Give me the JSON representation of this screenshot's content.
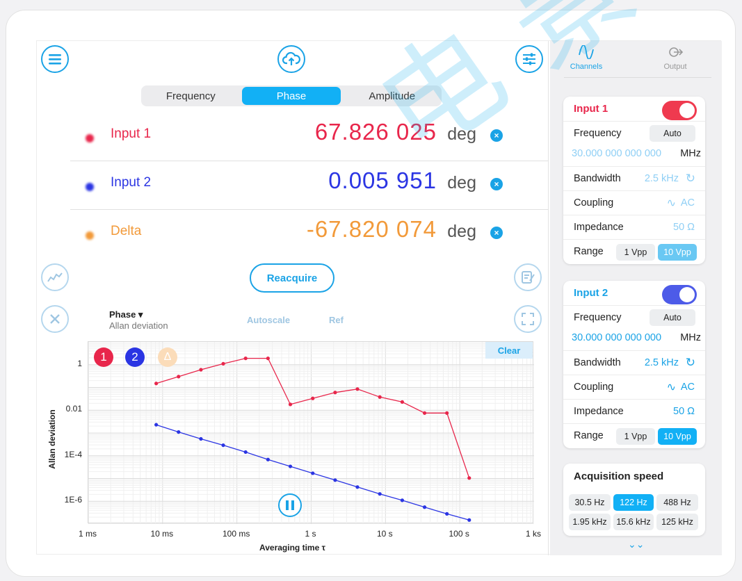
{
  "top_segment": {
    "items": [
      "Frequency",
      "Phase",
      "Amplitude"
    ],
    "active": "Phase"
  },
  "readings": [
    {
      "name": "Input 1",
      "value": "67.826 025",
      "unit": "deg",
      "color": "#e8264b"
    },
    {
      "name": "Input 2",
      "value": "0.005 951",
      "unit": "deg",
      "color": "#2b35e3"
    },
    {
      "name": "Delta",
      "value": "-67.820 074",
      "unit": "deg",
      "color": "#f29a3a"
    }
  ],
  "reacquire_label": "Reacquire",
  "plot_controls": {
    "mode": "Phase",
    "mode_sub": "Allan deviation",
    "autoscale": "Autoscale",
    "ref": "Ref",
    "clear": "Clear"
  },
  "channel_badges": [
    "1",
    "2",
    "Δ"
  ],
  "right_tabs": [
    {
      "label": "Channels",
      "active": true
    },
    {
      "label": "Output",
      "active": false
    }
  ],
  "input1": {
    "title": "Input 1",
    "enabled": true,
    "frequency_label": "Frequency",
    "frequency_mode": "Auto",
    "frequency_value": "30.000 000 000 000",
    "frequency_unit": "MHz",
    "bandwidth_label": "Bandwidth",
    "bandwidth_value": "2.5 kHz",
    "coupling_label": "Coupling",
    "coupling_value": "AC",
    "impedance_label": "Impedance",
    "impedance_value": "50 Ω",
    "range_label": "Range",
    "range_options": [
      "1 Vpp",
      "10 Vpp"
    ],
    "range_selected": "10 Vpp"
  },
  "input2": {
    "title": "Input 2",
    "enabled": true,
    "frequency_label": "Frequency",
    "frequency_mode": "Auto",
    "frequency_value": "30.000 000 000 000",
    "frequency_unit": "MHz",
    "bandwidth_label": "Bandwidth",
    "bandwidth_value": "2.5 kHz",
    "coupling_label": "Coupling",
    "coupling_value": "AC",
    "impedance_label": "Impedance",
    "impedance_value": "50 Ω",
    "range_label": "Range",
    "range_options": [
      "1 Vpp",
      "10 Vpp"
    ],
    "range_selected": "10 Vpp"
  },
  "acq": {
    "title": "Acquisition speed",
    "options": [
      "30.5 Hz",
      "122 Hz",
      "488 Hz",
      "1.95 kHz",
      "15.6 kHz",
      "125 kHz"
    ],
    "selected": "122 Hz"
  },
  "colors": {
    "accent": "#1aa3e6",
    "input1": "#e8264b",
    "input2": "#2b35e3",
    "delta": "#f29a3a",
    "toggle1": "#ef3a4f",
    "toggle2": "#4d5be8"
  },
  "watermark": "电 景 翼 光 电",
  "chart_data": {
    "type": "scatter",
    "xscale": "log",
    "yscale": "log",
    "xlabel": "Averaging time τ",
    "ylabel": "Allan deviation",
    "xlim": [
      0.001,
      1000
    ],
    "ylim": [
      1e-07,
      10
    ],
    "xticks": [
      {
        "v": 0.001,
        "label": "1 ms"
      },
      {
        "v": 0.01,
        "label": "10 ms"
      },
      {
        "v": 0.1,
        "label": "100 ms"
      },
      {
        "v": 1,
        "label": "1 s"
      },
      {
        "v": 10,
        "label": "10 s"
      },
      {
        "v": 100,
        "label": "100 s"
      },
      {
        "v": 1000,
        "label": "1 ks"
      }
    ],
    "yticks": [
      {
        "v": 1,
        "label": "1"
      },
      {
        "v": 0.01,
        "label": "0.01"
      },
      {
        "v": 0.0001,
        "label": "1E-4"
      },
      {
        "v": 1e-06,
        "label": "1E-6"
      }
    ],
    "grid": true,
    "series": [
      {
        "name": "1",
        "color": "#e8264b",
        "x": [
          0.0082,
          0.0164,
          0.0328,
          0.0655,
          0.131,
          0.262,
          0.524,
          1.05,
          2.1,
          4.19,
          8.39,
          16.8,
          33.6,
          67.1,
          134
        ],
        "y": [
          0.15,
          0.3,
          0.6,
          1.1,
          1.9,
          1.9,
          0.018,
          0.033,
          0.06,
          0.085,
          0.038,
          0.023,
          0.0075,
          0.0075,
          1.05e-05
        ]
      },
      {
        "name": "2",
        "color": "#2b35e3",
        "x": [
          0.0082,
          0.0164,
          0.0328,
          0.0655,
          0.131,
          0.262,
          0.524,
          1.05,
          2.1,
          4.19,
          8.39,
          16.8,
          33.6,
          67.1,
          134
        ],
        "y": [
          0.0023,
          0.0011,
          0.00055,
          0.00029,
          0.000145,
          6.8e-05,
          3.4e-05,
          1.7e-05,
          8.5e-06,
          4.2e-06,
          2.1e-06,
          1.1e-06,
          5.5e-07,
          2.8e-07,
          1.5e-07
        ]
      }
    ]
  }
}
